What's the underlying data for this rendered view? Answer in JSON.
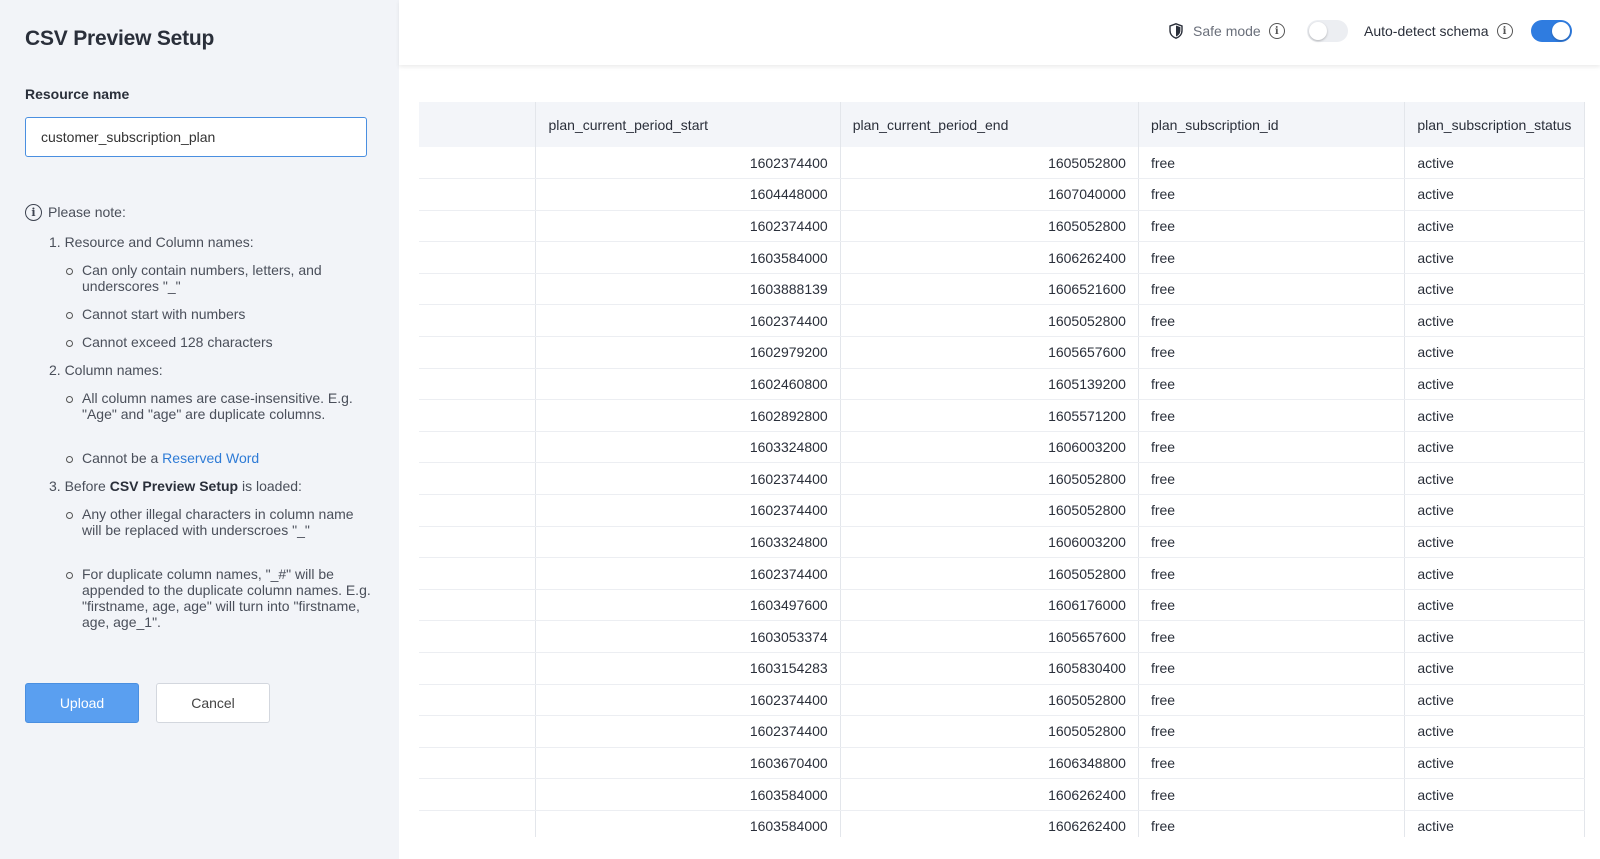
{
  "setup": {
    "title": "CSV Preview Setup",
    "resource_label": "Resource name",
    "resource_value": "customer_subscription_plan",
    "note_title": "Please note:",
    "rules": {
      "r1": "1. Resource and Column names:",
      "r1a": "Can only contain numbers, letters, and underscores \"_\"",
      "r1b": "Cannot start with numbers",
      "r1c": "Cannot exceed 128 characters",
      "r2": "2. Column names:",
      "r2a": "All column names are case-insensitive. E.g. \"Age\" and \"age\" are duplicate columns.",
      "r2b_prefix": "Cannot be a ",
      "r2b_link": "Reserved Word",
      "r3_prefix": "3. Before ",
      "r3_bold": "CSV Preview Setup",
      "r3_suffix": " is loaded:",
      "r3a": "Any other illegal characters in column name will be replaced with underscroes \"_\"",
      "r3b": "For duplicate column names, \"_#\" will be appended to the duplicate column names. E.g. \"firstname, age, age\" will turn into \"firstname, age, age_1\"."
    },
    "upload_label": "Upload",
    "cancel_label": "Cancel"
  },
  "topbar": {
    "safe_mode_label": "Safe mode",
    "safe_mode_on": false,
    "auto_detect_label": "Auto-detect schema",
    "auto_detect_on": true
  },
  "table": {
    "columns": [
      "",
      "plan_current_period_start",
      "plan_current_period_end",
      "plan_subscription_id",
      "plan_subscription_status"
    ],
    "rows": [
      [
        "",
        "1602374400",
        "1605052800",
        "free",
        "active"
      ],
      [
        "",
        "1604448000",
        "1607040000",
        "free",
        "active"
      ],
      [
        "",
        "1602374400",
        "1605052800",
        "free",
        "active"
      ],
      [
        "",
        "1603584000",
        "1606262400",
        "free",
        "active"
      ],
      [
        "",
        "1603888139",
        "1606521600",
        "free",
        "active"
      ],
      [
        "",
        "1602374400",
        "1605052800",
        "free",
        "active"
      ],
      [
        "",
        "1602979200",
        "1605657600",
        "free",
        "active"
      ],
      [
        "",
        "1602460800",
        "1605139200",
        "free",
        "active"
      ],
      [
        "",
        "1602892800",
        "1605571200",
        "free",
        "active"
      ],
      [
        "",
        "1603324800",
        "1606003200",
        "free",
        "active"
      ],
      [
        "",
        "1602374400",
        "1605052800",
        "free",
        "active"
      ],
      [
        "",
        "1602374400",
        "1605052800",
        "free",
        "active"
      ],
      [
        "",
        "1603324800",
        "1606003200",
        "free",
        "active"
      ],
      [
        "",
        "1602374400",
        "1605052800",
        "free",
        "active"
      ],
      [
        "",
        "1603497600",
        "1606176000",
        "free",
        "active"
      ],
      [
        "",
        "1603053374",
        "1605657600",
        "free",
        "active"
      ],
      [
        "",
        "1603154283",
        "1605830400",
        "free",
        "active"
      ],
      [
        "",
        "1602374400",
        "1605052800",
        "free",
        "active"
      ],
      [
        "",
        "1602374400",
        "1605052800",
        "free",
        "active"
      ],
      [
        "",
        "1603670400",
        "1606348800",
        "free",
        "active"
      ],
      [
        "",
        "1603584000",
        "1606262400",
        "free",
        "active"
      ],
      [
        "",
        "1603584000",
        "1606262400",
        "free",
        "active"
      ]
    ]
  },
  "colors": {
    "accent": "#2f7ce0",
    "upload_bg": "#5a9ff0",
    "panel_bg": "#f2f4f8",
    "link": "#2e7bd6"
  }
}
